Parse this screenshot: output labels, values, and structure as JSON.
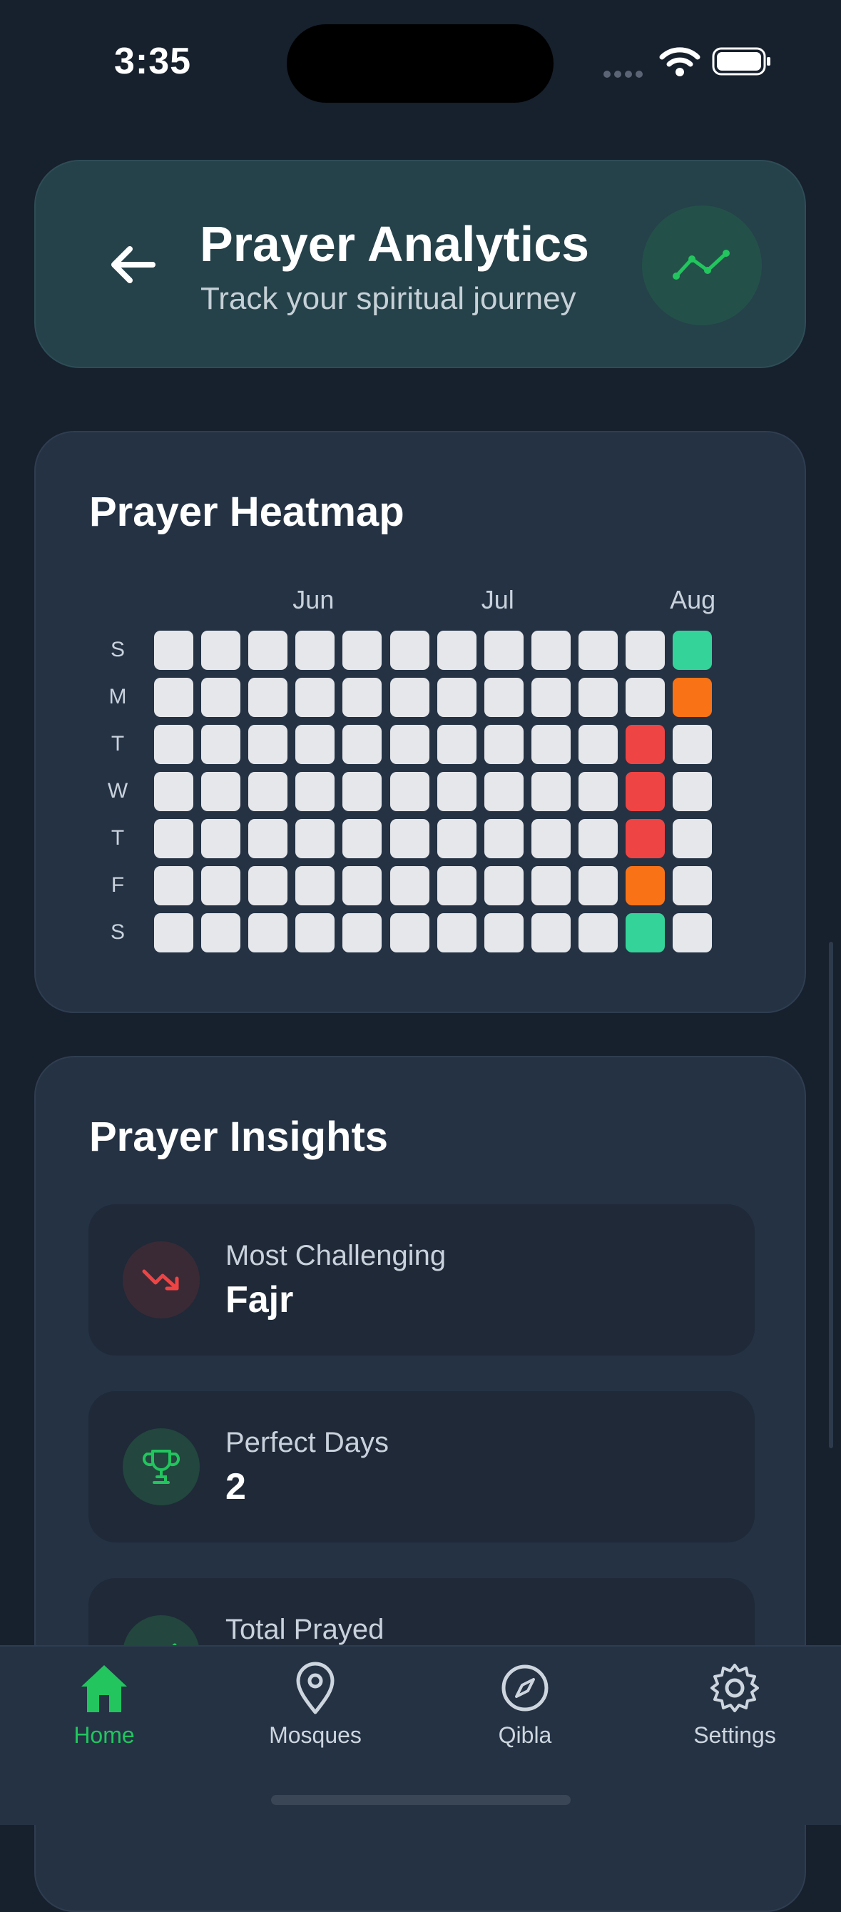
{
  "status_bar": {
    "time": "3:35"
  },
  "header": {
    "title": "Prayer Analytics",
    "subtitle": "Track your spiritual journey",
    "icon": "trend-line-icon",
    "accent": "#22c55e"
  },
  "heatmap": {
    "title": "Prayer Heatmap",
    "months": [
      "Jun",
      "Jul",
      "Aug"
    ],
    "days": [
      "S",
      "M",
      "T",
      "W",
      "T",
      "F",
      "S"
    ],
    "colors": {
      "empty": "#e6e7ea",
      "full": "#34d399",
      "partial": "#f97316",
      "missed": "#ef4444"
    },
    "columns": 12,
    "marked_cells": [
      {
        "day": 0,
        "week": 11,
        "status": "full"
      },
      {
        "day": 1,
        "week": 11,
        "status": "partial"
      },
      {
        "day": 2,
        "week": 10,
        "status": "missed"
      },
      {
        "day": 3,
        "week": 10,
        "status": "missed"
      },
      {
        "day": 4,
        "week": 10,
        "status": "missed"
      },
      {
        "day": 5,
        "week": 10,
        "status": "partial"
      },
      {
        "day": 6,
        "week": 10,
        "status": "full"
      }
    ]
  },
  "insights": {
    "title": "Prayer Insights",
    "items": [
      {
        "label": "Most Challenging",
        "value": "Fajr",
        "icon": "trending-down-icon"
      },
      {
        "label": "Perfect Days",
        "value": "2",
        "icon": "trophy-icon"
      },
      {
        "label": "Total Prayed",
        "value": "",
        "icon": "check-icon"
      }
    ]
  },
  "tabs": [
    {
      "label": "Home",
      "icon": "home-icon",
      "active": true
    },
    {
      "label": "Mosques",
      "icon": "map-pin-icon",
      "active": false
    },
    {
      "label": "Qibla",
      "icon": "compass-icon",
      "active": false
    },
    {
      "label": "Settings",
      "icon": "gear-icon",
      "active": false
    }
  ]
}
